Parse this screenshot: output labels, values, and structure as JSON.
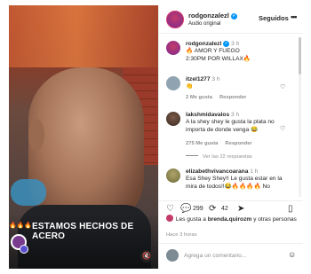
{
  "video": {
    "caption": "ESTAMOS HECHOS DE ACERO",
    "flames": "🔥🔥🔥",
    "mute_icon": "speaker-muted-icon"
  },
  "post": {
    "username": "rodgonzalezl",
    "audio": "Audio original",
    "follow_label": "Seguidos",
    "more": "•••"
  },
  "comments": [
    {
      "user": "rodgonzalezl",
      "time": "3 h",
      "text": "🔥 AMOR Y FUEGO",
      "text2": "2:30PM POR WILLAX🔥"
    },
    {
      "user": "itzel1277",
      "time": "3 h",
      "text": "👏",
      "likes": "2 Me gusta",
      "reply": "Responder"
    },
    {
      "user": "lakshmidavalos",
      "time": "3 h",
      "text": "A la shey shey le gusta la plata no importa de donde venga 😂",
      "likes": "275 Me gusta",
      "reply": "Responder",
      "replies": "Ver las 22 respuestas"
    },
    {
      "user": "elizabethvivancoarana",
      "time": "1 h",
      "text": "Esa Shey Shey!! Le gusta estar en la mira de todos!!😂🔥🔥🔥🔥 No"
    }
  ],
  "actions": {
    "comment_count": "299",
    "repost_count": "42"
  },
  "likes_text": "Les gusta a",
  "likes_user": "brenda.quirozm",
  "likes_rest": "y otras personas",
  "posted_ago": "Hace 3 horas",
  "composer": {
    "placeholder": "Agrega un comentario..."
  },
  "colors": {
    "accent": "#0095f6",
    "text": "#262626",
    "muted": "#8e8e8e"
  }
}
